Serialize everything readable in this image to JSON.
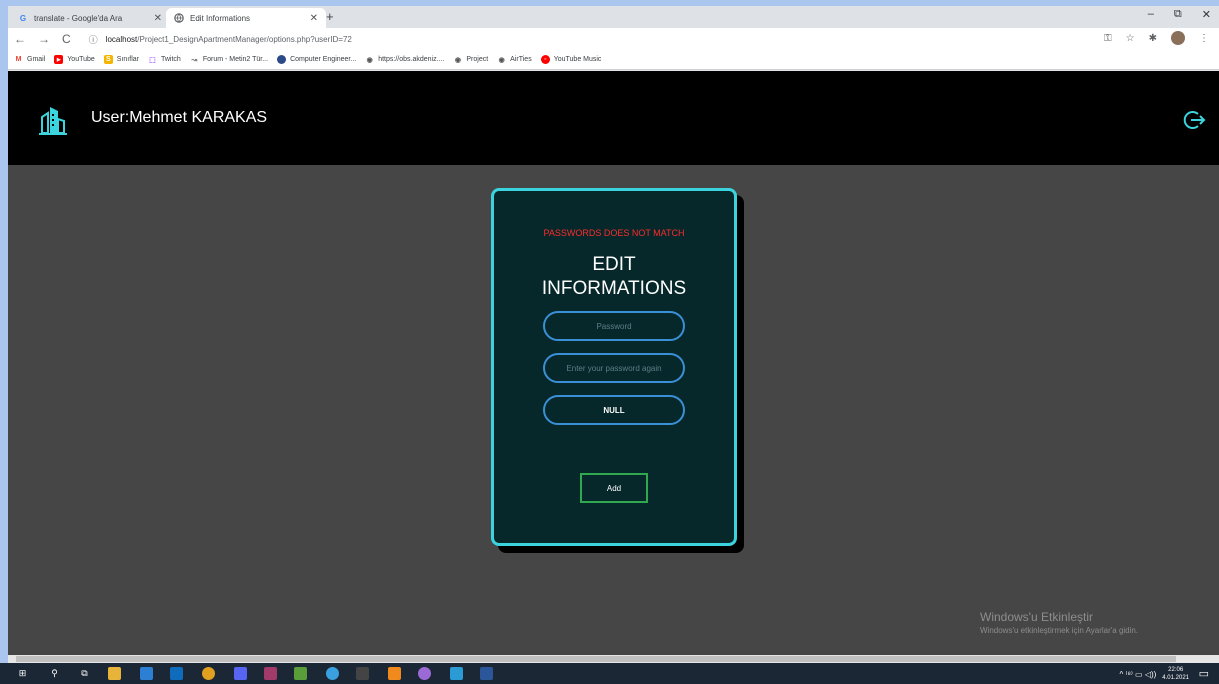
{
  "browser": {
    "tabs": [
      {
        "title": "translate - Google'da Ara",
        "favicon": "google-icon",
        "active": false
      },
      {
        "title": "Edit Informations",
        "favicon": "globe-icon",
        "active": true
      }
    ],
    "new_tab_glyph": "+",
    "window_controls": {
      "minimize": "–",
      "restore": "⧉",
      "close": "✕"
    },
    "nav": {
      "back": "←",
      "forward": "→",
      "reload": "C"
    },
    "address": {
      "host": "localhost",
      "path": "/Project1_DesignApartmentManager/options.php?userID=72"
    },
    "bookmarks": [
      {
        "label": "Gmail",
        "icon": "gmail-icon",
        "color": "#ea4335",
        "glyph": "M"
      },
      {
        "label": "YouTube",
        "icon": "youtube-icon",
        "color": "#ff0000",
        "glyph": "▶"
      },
      {
        "label": "Sınıflar",
        "icon": "classroom-icon",
        "color": "#f4b400",
        "glyph": "S"
      },
      {
        "label": "Twitch",
        "icon": "twitch-icon",
        "color": "#9146ff",
        "glyph": "T"
      },
      {
        "label": "Forum - Metin2 Tür...",
        "icon": "forum-icon",
        "color": "#777777",
        "glyph": "↝"
      },
      {
        "label": "Computer Engineer...",
        "icon": "linkedin-icon",
        "color": "#2c4a8a",
        "glyph": "●"
      },
      {
        "label": "https://obs.akdeniz....",
        "icon": "globe-icon",
        "color": "#555555",
        "glyph": "◉"
      },
      {
        "label": "Project",
        "icon": "globe-icon",
        "color": "#555555",
        "glyph": "◉"
      },
      {
        "label": "AirTies",
        "icon": "globe-icon",
        "color": "#555555",
        "glyph": "◉"
      },
      {
        "label": "YouTube Music",
        "icon": "youtube-music-icon",
        "color": "#ff0000",
        "glyph": "◉"
      }
    ]
  },
  "header": {
    "user_label": "User:Mehmet KARAKAS",
    "logo_icon": "building-icon",
    "logout_icon": "logout-icon",
    "accent_color": "#3bd3dd"
  },
  "form": {
    "error": "PASSWORDS DOES NOT MATCH",
    "title_line1": "EDIT",
    "title_line2": "INFORMATIONS",
    "password_placeholder": "Password",
    "password_again_placeholder": "Enter your password again",
    "null_button": "NULL",
    "add_button": "Add"
  },
  "watermark": {
    "line1": "Windows'u Etkinleştir",
    "line2": "Windows'u etkinleştirmek için Ayarlar'a gidin."
  },
  "taskbar": {
    "time": "22:06",
    "date": "4.01.2021",
    "tray_glyphs": "^ ⁽⁸⁾ ▭ ◁))"
  }
}
